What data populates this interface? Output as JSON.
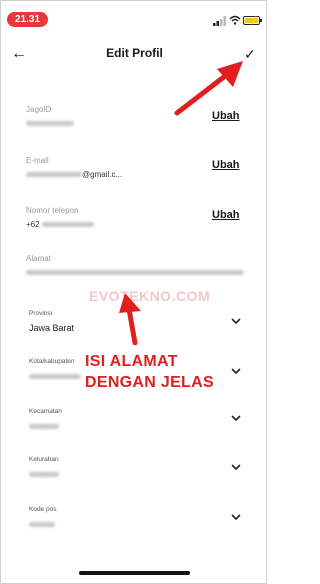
{
  "status_bar": {
    "time": "21.31"
  },
  "header": {
    "back_icon": "arrow-left-icon",
    "title": "Edit Profil",
    "save_icon": "check-icon"
  },
  "fields": {
    "jagoid": {
      "label": "JagoID",
      "action": "Ubah"
    },
    "email": {
      "label": "E-mail",
      "value_suffix": "@gmail.c...",
      "action": "Ubah"
    },
    "phone": {
      "label": "Nomor telepon",
      "value_prefix": "+62",
      "action": "Ubah"
    },
    "address": {
      "label": "Alamat"
    }
  },
  "dropdowns": [
    {
      "label": "Provinsi",
      "value": "Jawa Barat"
    },
    {
      "label": "Kota/kabupaten",
      "value": ""
    },
    {
      "label": "Kecamatan",
      "value": ""
    },
    {
      "label": "Kelurahan",
      "value": ""
    },
    {
      "label": "Kode pos",
      "value": ""
    }
  ],
  "overlay": {
    "watermark": "EVOTEKNO.COM",
    "annotation_line1": "ISI ALAMAT",
    "annotation_line2": "DENGAN JELAS",
    "accent_color": "#e02020"
  }
}
